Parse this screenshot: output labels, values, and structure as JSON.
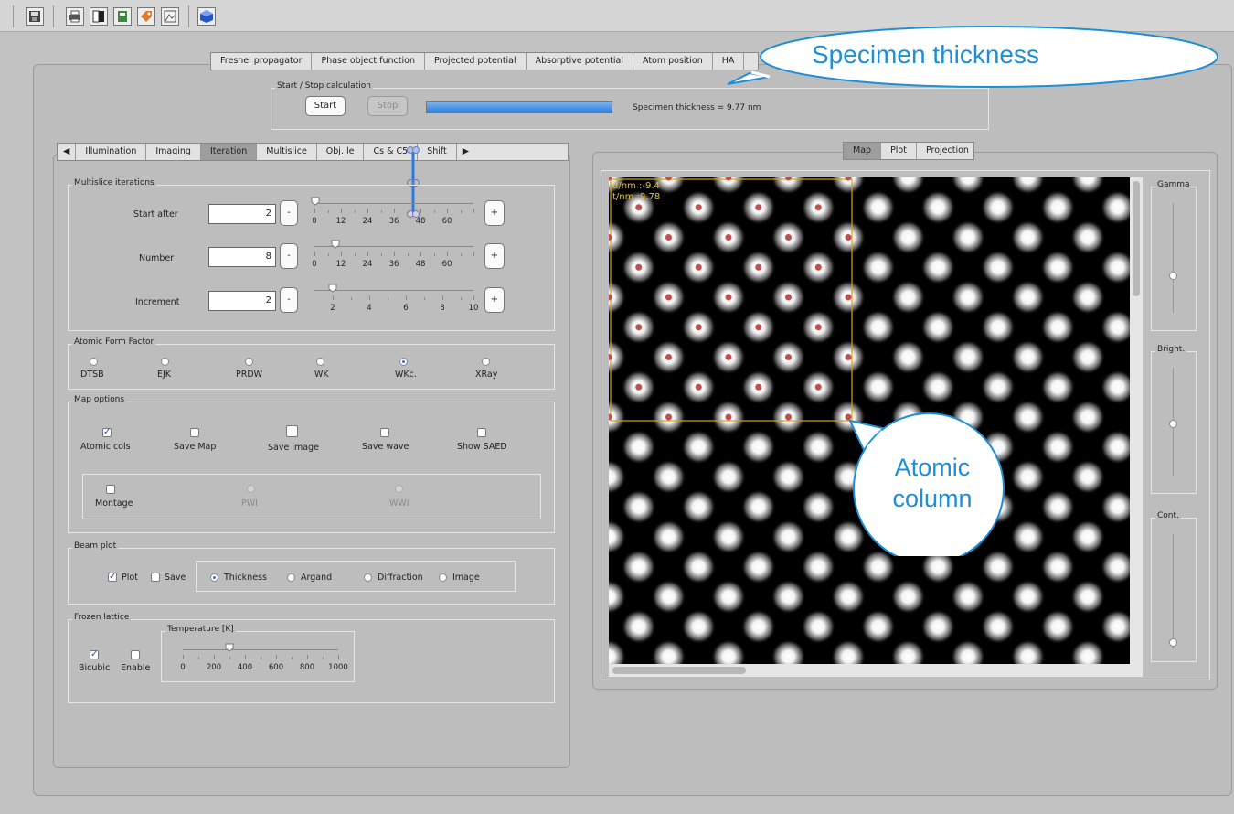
{
  "toolbar": {
    "icons": [
      "save-icon",
      "print-icon",
      "contrast-icon",
      "export-icon",
      "tag-icon",
      "image-icon",
      "cube-icon"
    ]
  },
  "top_tabs": {
    "items": [
      "Fresnel propagator",
      "Phase object function",
      "Projected potential",
      "Absorptive potential",
      "Atom position",
      "HA"
    ]
  },
  "calc": {
    "group_label": "Start / Stop calculation",
    "start_label": "Start",
    "stop_label": "Stop",
    "progress": 1.0,
    "status": "Specimen thickness = 9.77 nm"
  },
  "left_tabs": {
    "items": [
      "Illumination",
      "Imaging",
      "Iteration",
      "Multislice",
      "Obj. le",
      "Cs & C5",
      "Shift"
    ],
    "active": "Iteration"
  },
  "multislice": {
    "label": "Multislice iterations",
    "start_after": {
      "label": "Start after",
      "value": "2",
      "ticks": [
        "0",
        "12",
        "24",
        "36",
        "48",
        "60"
      ]
    },
    "number": {
      "label": "Number",
      "value": "8",
      "ticks": [
        "0",
        "12",
        "24",
        "36",
        "48",
        "60"
      ]
    },
    "increment": {
      "label": "Increment",
      "value": "2",
      "ticks": [
        "2",
        "4",
        "6",
        "8",
        "10"
      ]
    },
    "minus": "-",
    "plus": "+"
  },
  "form_factor": {
    "label": "Atomic Form Factor",
    "options": [
      "DTSB",
      "EJK",
      "PRDW",
      "WK",
      "WKc.",
      "XRay"
    ],
    "selected": "WKc."
  },
  "map_options": {
    "label": "Map options",
    "atomic_cols": "Atomic cols",
    "save_map": "Save Map",
    "save_image": "Save image",
    "save_wave": "Save wave",
    "show_saed": "Show SAED",
    "montage": "Montage",
    "pwi": "PWI",
    "wwi": "WWI"
  },
  "beam_plot": {
    "label": "Beam plot",
    "plot": "Plot",
    "save": "Save",
    "thickness": "Thickness",
    "argand": "Argand",
    "diffraction": "Diffraction",
    "image": "Image"
  },
  "frozen": {
    "label": "Frozen lattice",
    "bicubic": "Bicubic",
    "enable": "Enable",
    "temp_label": "Temperature [K]",
    "ticks": [
      "0",
      "200",
      "400",
      "600",
      "800",
      "1000"
    ]
  },
  "right_tabs": {
    "items": [
      "Map",
      "Plot",
      "Projection"
    ],
    "active": "Map"
  },
  "map": {
    "readout_d": "d/nm :-9.4",
    "readout_t": "t/nm :9.78"
  },
  "sliders": {
    "gamma": "Gamma",
    "bright": "Bright.",
    "cont": "Cont."
  },
  "callouts": {
    "thickness": "Specimen thickness",
    "atomic_line1": "Atomic",
    "atomic_line2": "column"
  },
  "colors": {
    "accent": "#1e8fd6",
    "progress": "#3f8ee0",
    "frame_box": "#d6a21a",
    "atom_dot": "#c0504d"
  }
}
